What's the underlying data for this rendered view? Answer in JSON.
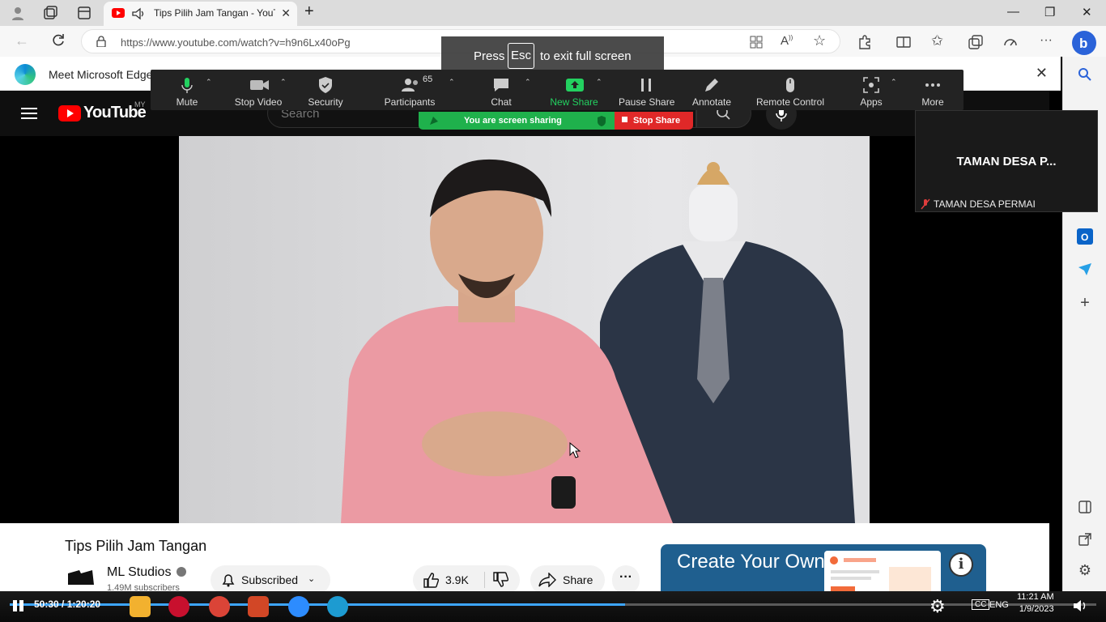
{
  "browser": {
    "tab_title": "Tips Pilih Jam Tangan - YouTube",
    "url": "https://www.youtube.com/watch?v=h9n6Lx40oPg"
  },
  "promo": {
    "text": "Meet Microsoft Edge"
  },
  "fullscreen_banner": {
    "press": "Press",
    "key": "Esc",
    "rest": "to exit full screen"
  },
  "zoom": {
    "toolbar": {
      "mute": "Mute",
      "stop_video": "Stop Video",
      "security": "Security",
      "participants": "Participants",
      "participants_count": "65",
      "chat": "Chat",
      "new_share": "New Share",
      "pause_share": "Pause Share",
      "annotate": "Annotate",
      "remote_control": "Remote Control",
      "apps": "Apps",
      "more": "More"
    },
    "sharing_status": "You are screen sharing",
    "stop_share": "Stop Share",
    "tile": {
      "name_large": "TAMAN DESA P...",
      "name_small": "TAMAN DESA PERMAI"
    }
  },
  "youtube": {
    "region": "MY",
    "search_placeholder": "Search",
    "video_title": "Tips Pilih Jam Tangan",
    "channel": {
      "name": "ML Studios",
      "subscribers": "1.49M subscribers"
    },
    "subscribe_label": "Subscribed",
    "likes": "3.9K",
    "share_label": "Share",
    "ad": {
      "headline": "Create Your Own Website"
    }
  },
  "player": {
    "time": "50:30 / 1:20:20",
    "progress": 0.566,
    "colors": {
      "progress": "#3da5ff"
    }
  },
  "system": {
    "time": "11:21 AM",
    "date": "1/9/2023",
    "lang": "ENG"
  }
}
